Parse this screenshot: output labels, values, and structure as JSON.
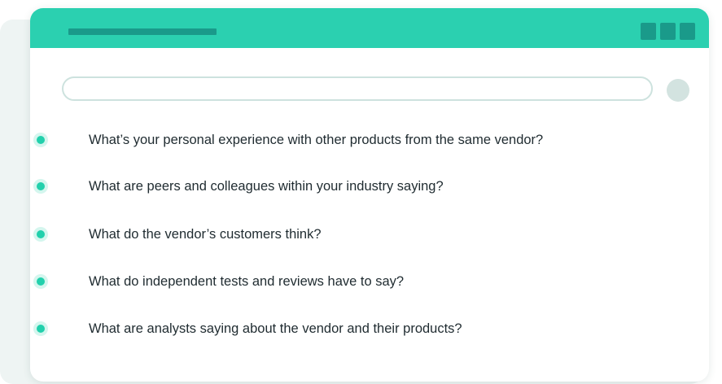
{
  "window": {
    "accent_color": "#2bd0b0",
    "title_placeholder_color": "#1a9a8a"
  },
  "search": {
    "value": "",
    "placeholder": ""
  },
  "questions": [
    "What’s your personal experience with other products from the same vendor?",
    "What are peers and colleagues within your industry saying?",
    "What do the vendor’s customers think?",
    "What do independent tests and reviews have to say?",
    "What are analysts saying about the vendor and their products?"
  ]
}
